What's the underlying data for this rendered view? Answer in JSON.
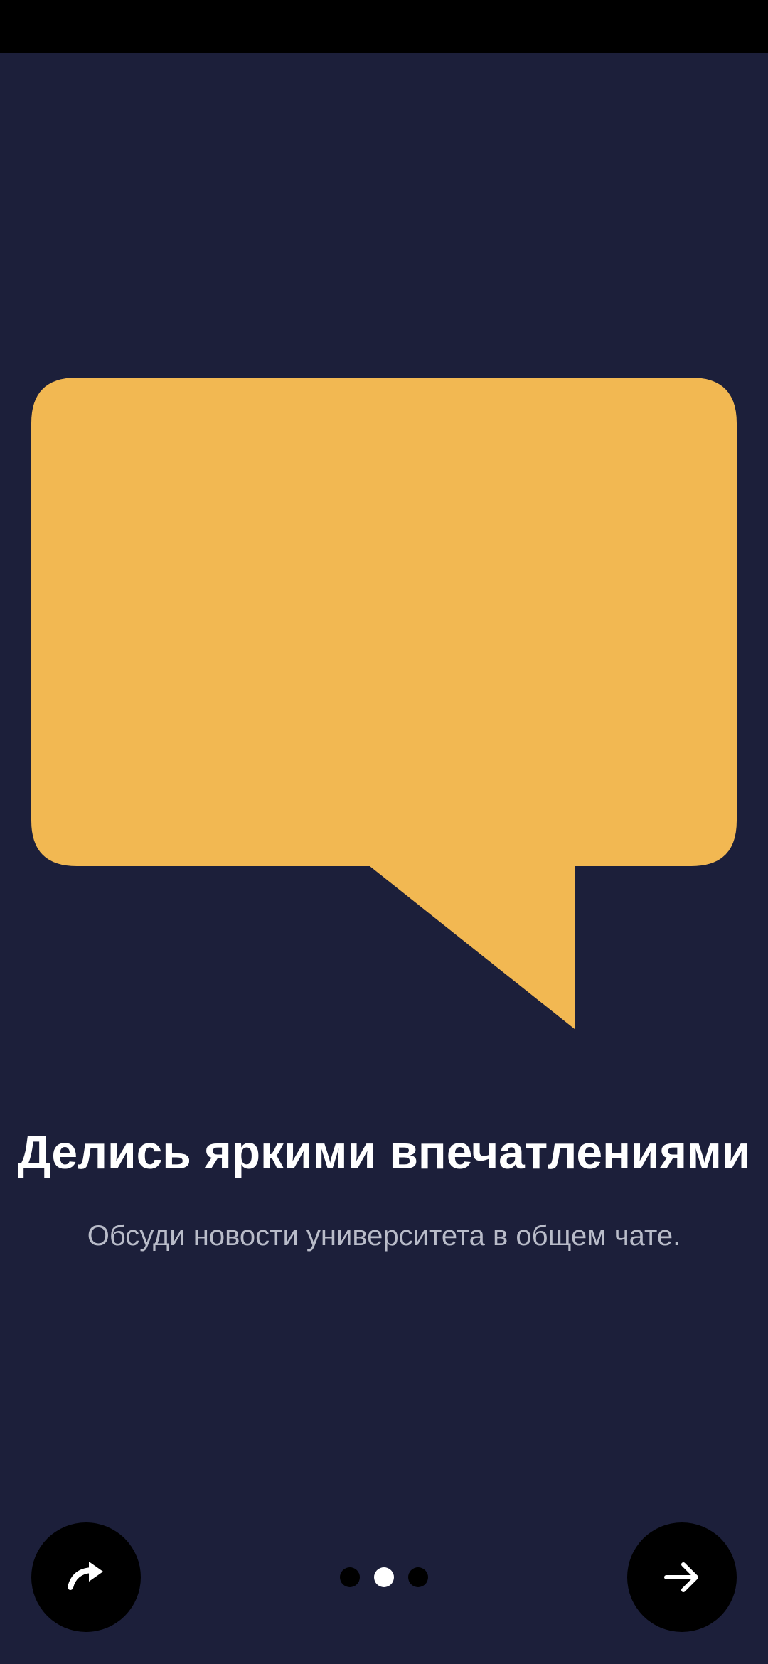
{
  "onboarding": {
    "title": "Делись яркими впечатлениями",
    "subtitle": "Обсуди новости университета в общем чате.",
    "page_indicator": {
      "total": 3,
      "active_index": 1
    },
    "buttons": {
      "skip_icon": "redo-arrow-icon",
      "next_icon": "arrow-right-icon"
    },
    "illustration": {
      "icon": "speech-bubble-icon",
      "color": "#f2b852"
    }
  },
  "colors": {
    "background": "#1c1f3a",
    "status_bar": "#000000",
    "title": "#ffffff",
    "subtitle": "#b9bcc9",
    "button_bg": "#000000",
    "dot_active": "#ffffff",
    "dot_inactive": "#000000"
  }
}
